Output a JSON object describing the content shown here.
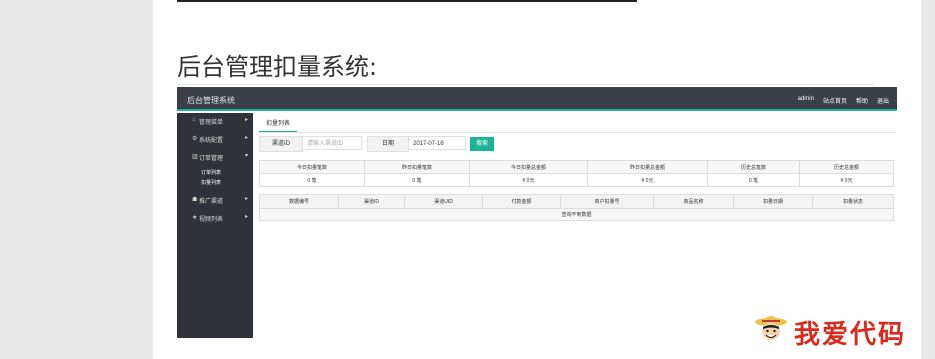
{
  "heading": "后台管理扣量系统:",
  "admin": {
    "brand": "后台管理系统",
    "topnav": [
      "admin",
      "站点首页",
      "帮助",
      "退出"
    ],
    "sidebar": {
      "items": [
        {
          "icon": "home-icon",
          "label": "管理菜单"
        },
        {
          "icon": "gear-icon",
          "label": "系统配置"
        },
        {
          "icon": "bar-chart-icon",
          "label": "订单管理"
        },
        {
          "icon": "user-icon",
          "label": "推广渠道"
        },
        {
          "icon": "star-icon",
          "label": "视频列表"
        }
      ],
      "subitems": [
        "订单列表",
        "扣量列表"
      ]
    },
    "tab": "扣量列表",
    "filter": {
      "channel_label": "渠道ID",
      "channel_placeholder": "请输入渠道ID",
      "date_label": "日期",
      "date_value": "2017-07-16",
      "search_button": "搜索"
    },
    "stats": {
      "headers": [
        "今日扣量笔数",
        "昨日扣量笔数",
        "今日扣量总金额",
        "昨日扣量总金额",
        "历史总笔数",
        "历史总金额"
      ],
      "values": [
        "0 笔",
        "0 笔",
        "¥ 0元",
        "¥ 0元",
        "0 笔",
        "¥ 0元"
      ]
    },
    "orders": {
      "headers": [
        "数据编号",
        "渠道ID",
        "渠道UID",
        "付款金额",
        "商户扣量号",
        "商品名称",
        "扣量日期",
        "扣量状态"
      ],
      "empty_text": "查询不到数据"
    }
  },
  "watermark": {
    "text": "我爱代码"
  }
}
